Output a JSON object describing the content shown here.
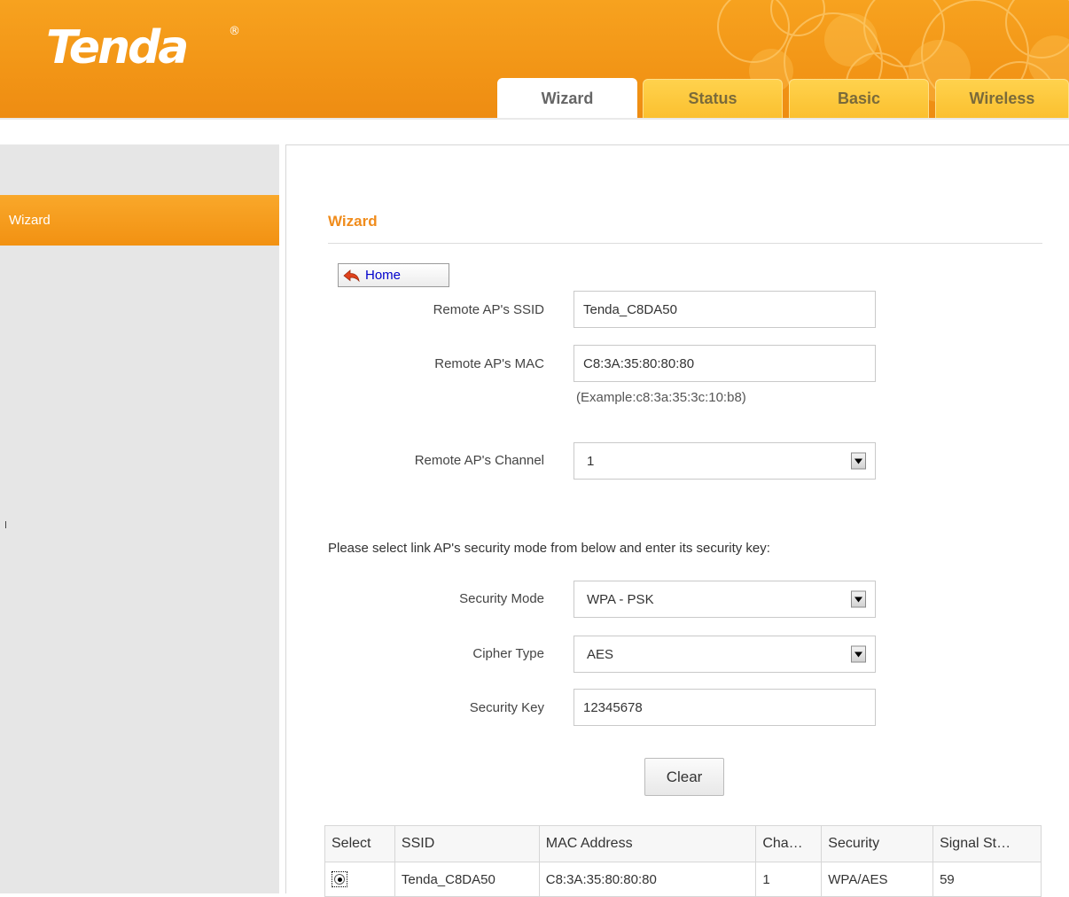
{
  "header": {
    "logo_text": "Tenda",
    "logo_mark": "®",
    "tabs": [
      {
        "label": "Wizard",
        "active": true
      },
      {
        "label": "Status",
        "active": false
      },
      {
        "label": "Basic",
        "active": false
      },
      {
        "label": "Wireless",
        "active": false
      }
    ]
  },
  "sidebar": {
    "items": [
      {
        "label": "Wizard",
        "active": true
      }
    ]
  },
  "main": {
    "title": "Wizard",
    "home_button": "Home",
    "fields": {
      "ssid": {
        "label": "Remote AP's SSID",
        "value": "Tenda_C8DA50"
      },
      "mac": {
        "label": "Remote AP's MAC",
        "value": "C8:3A:35:80:80:80",
        "hint": "(Example:c8:3a:35:3c:10:b8)"
      },
      "channel": {
        "label": "Remote AP's Channel",
        "value": "1"
      },
      "instruction": "Please select link AP's security mode from below and enter its security key:",
      "security_mode": {
        "label": "Security Mode",
        "value": "WPA - PSK"
      },
      "cipher_type": {
        "label": "Cipher Type",
        "value": "AES"
      },
      "security_key": {
        "label": "Security Key",
        "value": "12345678"
      }
    },
    "clear_button": "Clear",
    "table": {
      "headers": [
        "Select",
        "SSID",
        "MAC Address",
        "Cha…",
        "Security",
        "Signal St…"
      ],
      "rows": [
        {
          "selected": true,
          "ssid": "Tenda_C8DA50",
          "mac": "C8:3A:35:80:80:80",
          "channel": "1",
          "security": "WPA/AES",
          "signal": "59"
        }
      ]
    }
  },
  "colors": {
    "brand_orange": "#f29516",
    "title_orange": "#f08c1c",
    "tab_yellow": "#fbc02f",
    "sidebar_gray": "#e6e6e6",
    "link_blue": "#0000cc"
  },
  "icons": {
    "home_button_icon": "return-arrow-icon",
    "dropdown_icon": "dropdown-arrow-icon",
    "radio_icon": "radio-selected-icon"
  }
}
